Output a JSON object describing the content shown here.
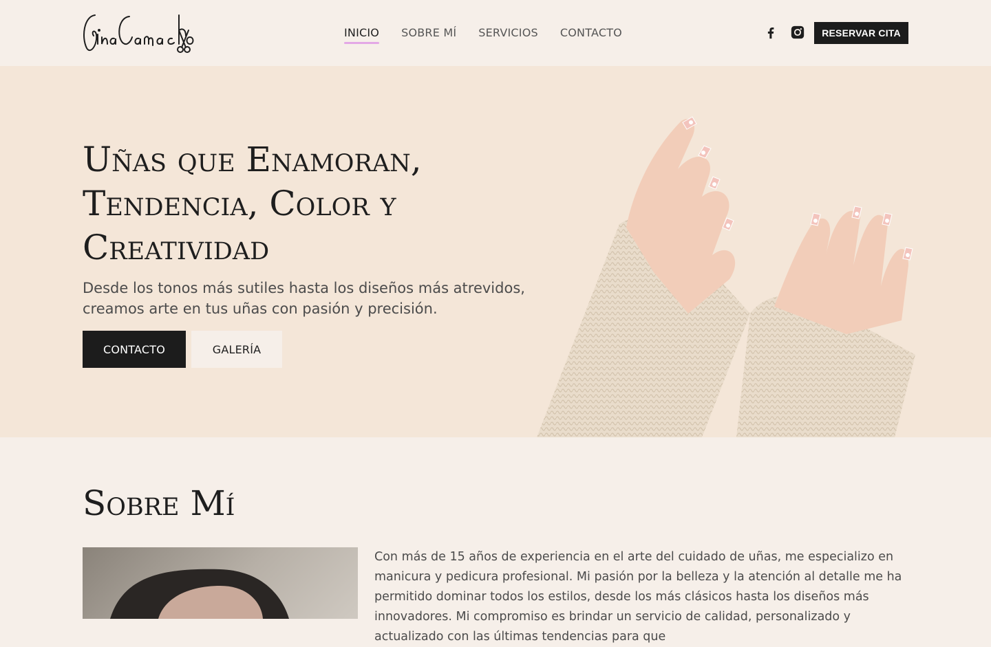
{
  "brand": {
    "logo_text": "GinaCamacho"
  },
  "nav": {
    "items": [
      {
        "label": "INICIO",
        "active": true
      },
      {
        "label": "SOBRE MÍ",
        "active": false
      },
      {
        "label": "SERVICIOS",
        "active": false
      },
      {
        "label": "CONTACTO",
        "active": false
      }
    ],
    "active_color": "#e3a8e6"
  },
  "social": {
    "icons": [
      "facebook-icon",
      "instagram-icon"
    ]
  },
  "header": {
    "cta_label": "RESERVAR CITA"
  },
  "hero": {
    "title": "Uñas que Enamoran, Tendencia, Color y Creatividad",
    "subtitle": "Desde los tonos más sutiles hasta los diseños más atrevidos, creamos arte en tus uñas con pasión y precisión.",
    "primary_button": "CONTACTO",
    "secondary_button": "GALERÍA",
    "background_color": "#f4e6d8"
  },
  "about": {
    "title": "Sobre Mí",
    "text": "Con más de 15 años de experiencia en el arte del cuidado de uñas, me especializo en manicura y pedicura profesional. Mi pasión por la belleza y la atención al detalle me ha permitido dominar todos los estilos, desde los más clásicos hasta los diseños más innovadores. Mi compromiso es brindar un servicio de calidad, personalizado y actualizado con las últimas tendencias para que"
  },
  "colors": {
    "dark": "#1c1c1c",
    "page_bg": "#f6efe9"
  }
}
